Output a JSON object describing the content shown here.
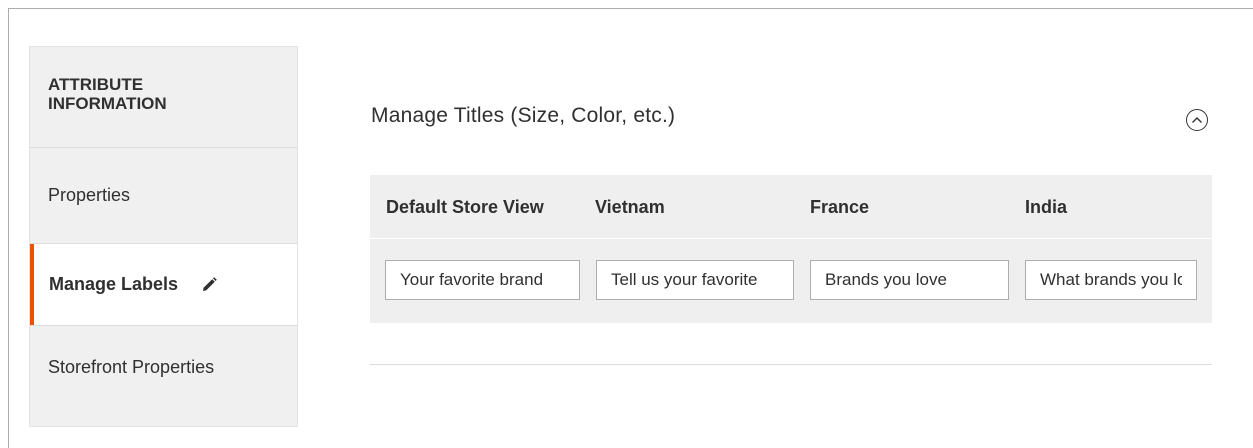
{
  "sidebar": {
    "title": "ATTRIBUTE\nINFORMATION",
    "items": [
      {
        "label": "Properties"
      },
      {
        "label": "Manage Labels",
        "active": true,
        "icon": "pencil-icon"
      },
      {
        "label": "Storefront Properties"
      }
    ]
  },
  "section": {
    "title": "Manage Titles (Size, Color, etc.)",
    "toggle_icon": "chevron-up-circle-icon"
  },
  "titles_table": {
    "headers": [
      "Default Store View",
      "Vietnam",
      "France",
      "India"
    ],
    "values": [
      "Your favorite brand",
      "Tell us your favorite",
      "Brands you love",
      "What brands you love"
    ]
  },
  "colors": {
    "accent": "#eb5202",
    "sidebar_bg": "#f0f0f0",
    "table_bg": "#efefef"
  }
}
